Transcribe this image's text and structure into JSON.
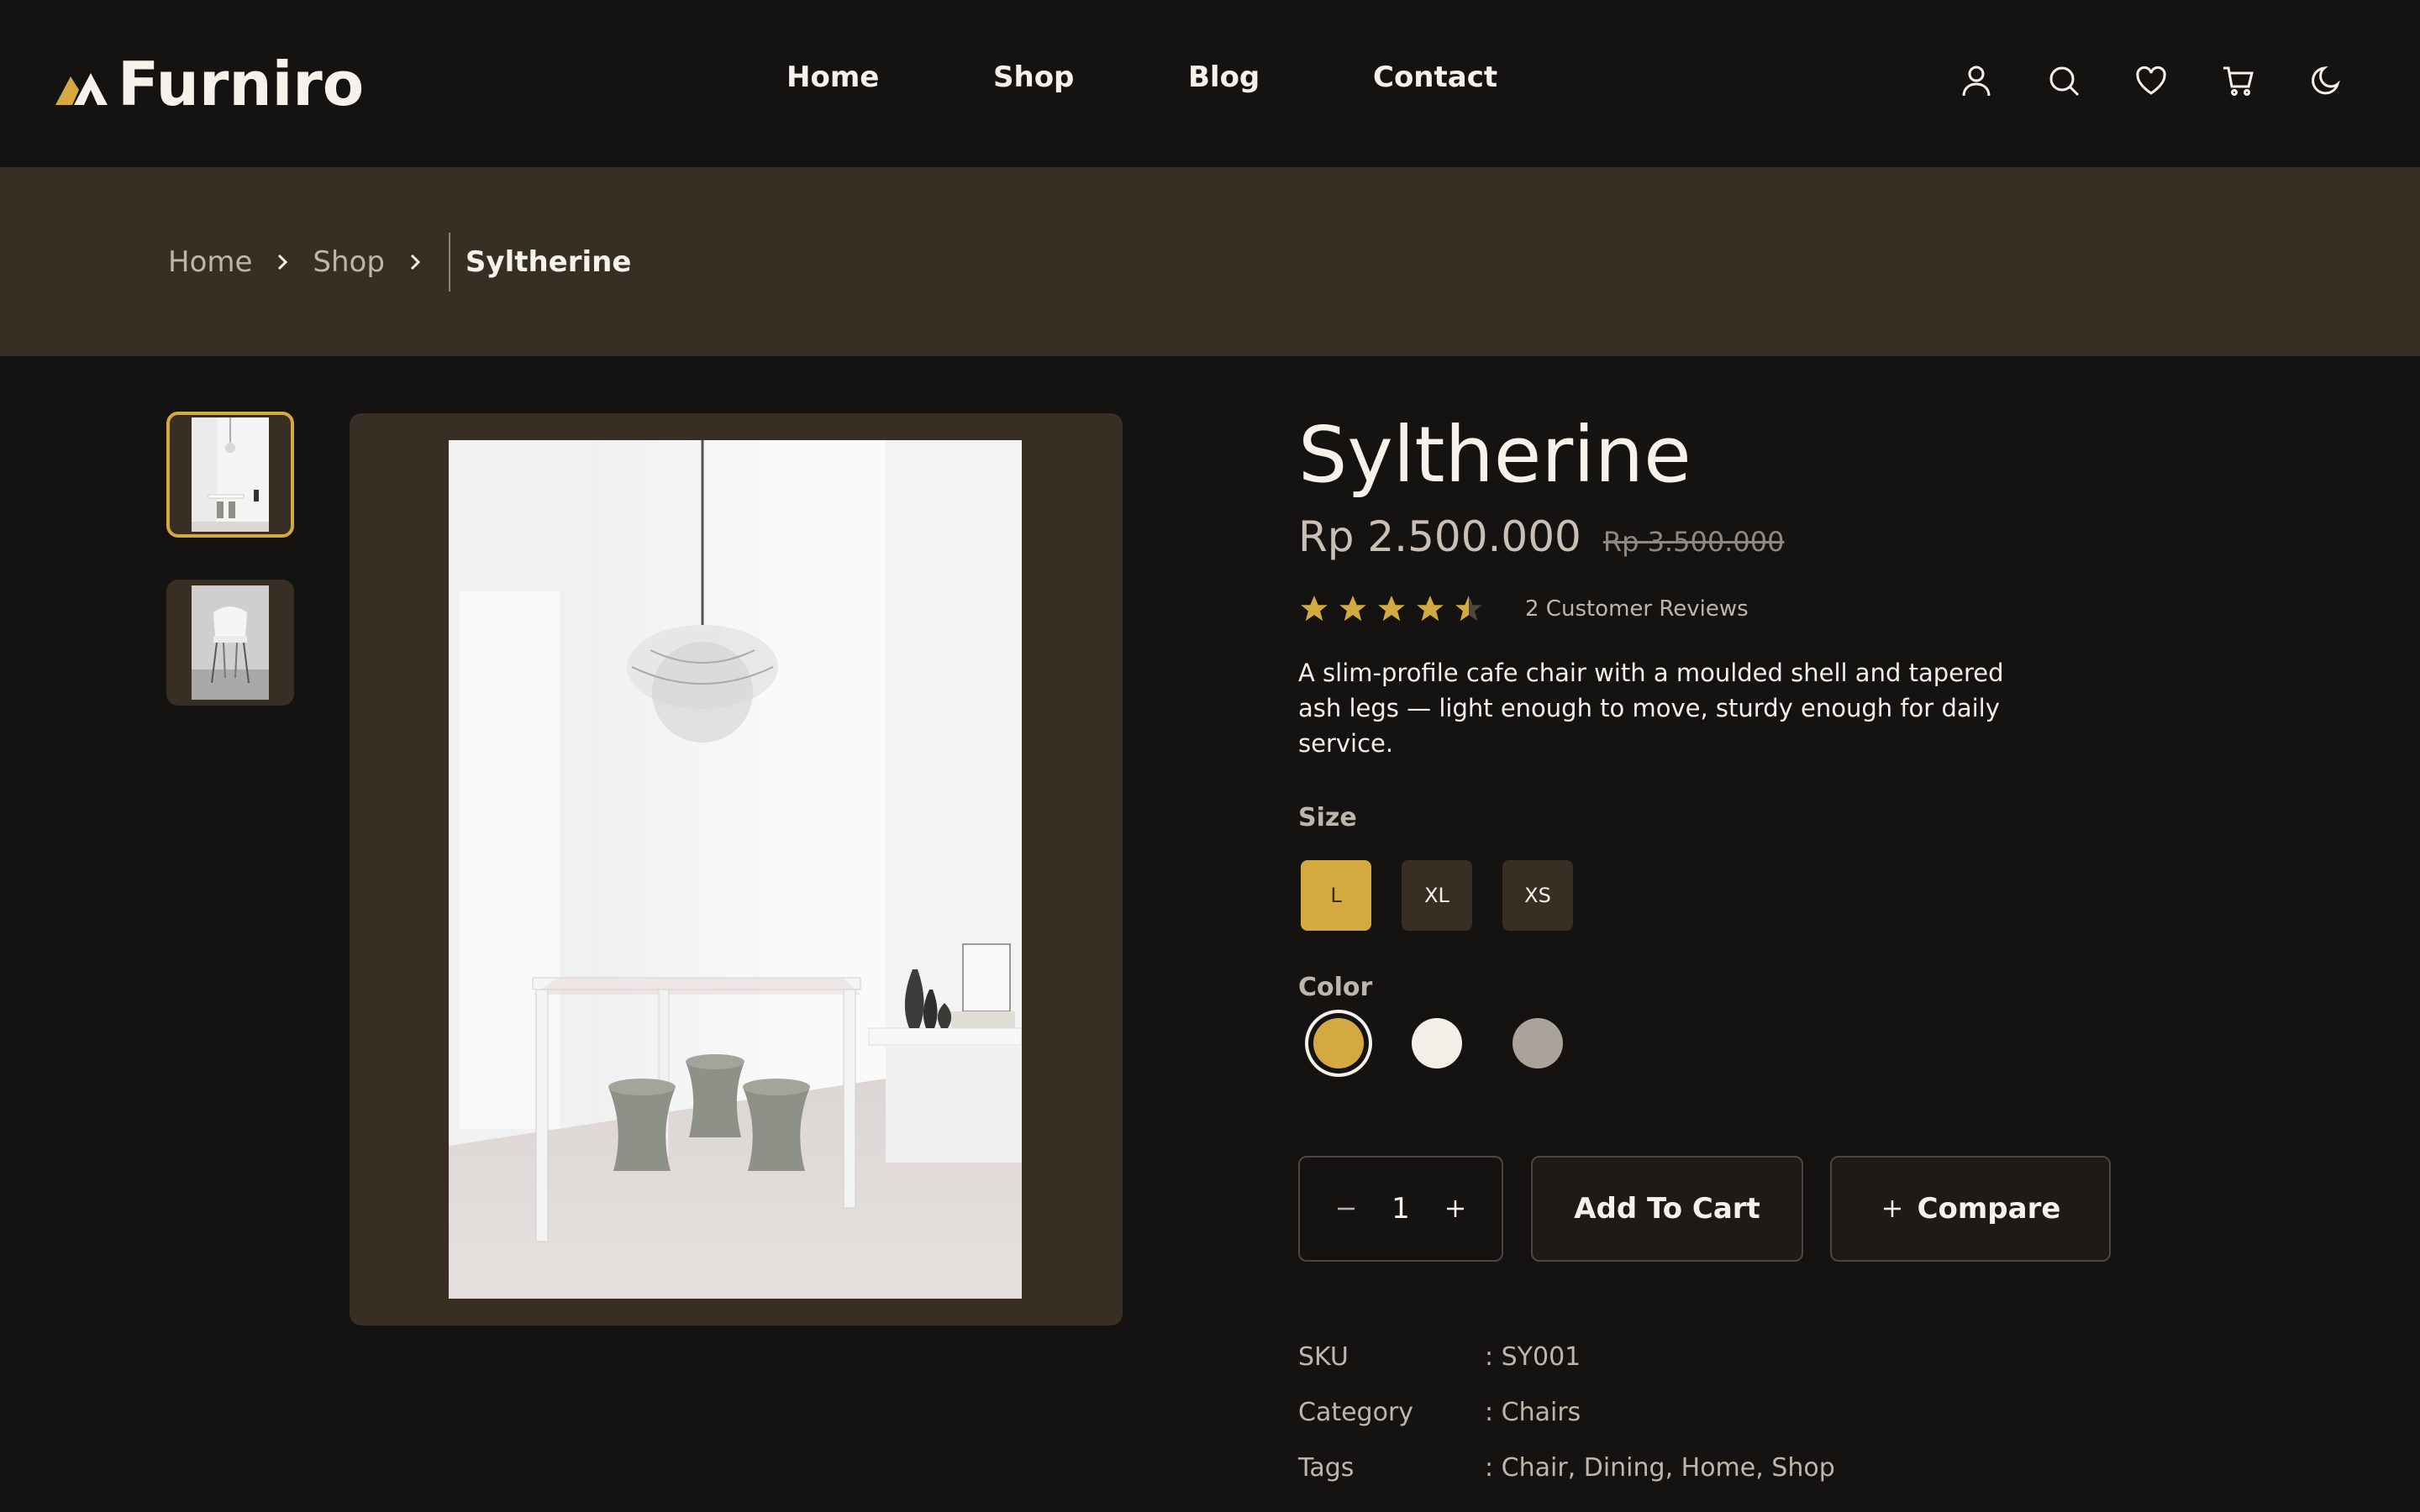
{
  "brand": {
    "name": "Furniro",
    "accent": "#d4a93f"
  },
  "nav": {
    "items": [
      "Home",
      "Shop",
      "Blog",
      "Contact"
    ]
  },
  "header_icons": [
    "user-icon",
    "search-icon",
    "heart-icon",
    "cart-icon",
    "moon-icon"
  ],
  "breadcrumb": {
    "items": [
      "Home",
      "Shop"
    ],
    "current": "Syltherine"
  },
  "gallery": {
    "thumbnails": [
      "dining-room-thumbnail",
      "white-chair-thumbnail"
    ],
    "active_index": 0
  },
  "product": {
    "title": "Syltherine",
    "price": "Rp 2.500.000",
    "old_price": "Rp 3.500.000",
    "rating": 4.5,
    "reviews_label": "2 Customer Reviews",
    "description": "A slim-profile cafe chair with a moulded shell and tapered ash legs — light enough to move, sturdy enough for daily service.",
    "size_label": "Size",
    "sizes": [
      "L",
      "XL",
      "XS"
    ],
    "selected_size": "L",
    "color_label": "Color",
    "colors": [
      "#d4a93f",
      "#f2efe9",
      "#aaa39a"
    ],
    "selected_color": "#d4a93f",
    "quantity": "1",
    "add_to_cart_label": "Add To Cart",
    "compare_label": "Compare"
  },
  "meta": {
    "sku_label": "SKU",
    "sku_value": ": SY001",
    "category_label": "Category",
    "category_value": ": Chairs",
    "tags_label": "Tags",
    "tags_value": ": Chair, Dining, Home, Shop"
  }
}
